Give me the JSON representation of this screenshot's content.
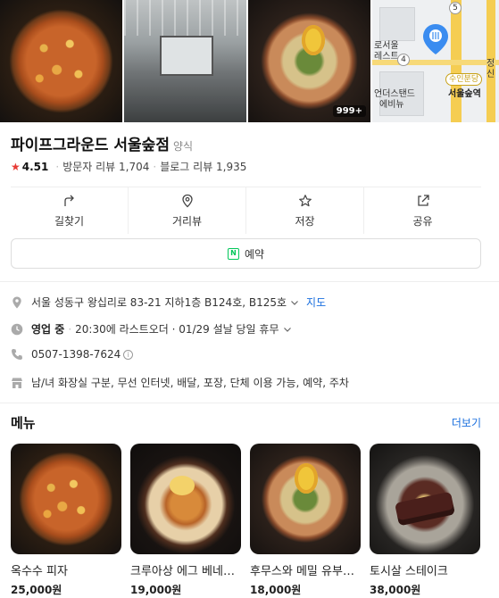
{
  "photos": {
    "count_badge": "999+"
  },
  "map": {
    "labels": [
      "로서울",
      "레스트",
      "언더스탠드",
      "에비뉴"
    ],
    "badges": [
      "5",
      "4"
    ],
    "station_tag": "수인분당",
    "station_name": "서울숲역",
    "side_label": "정신"
  },
  "place": {
    "name": "파이프그라운드 서울숲점",
    "category": "양식",
    "rating": "4.51",
    "visitor_reviews": "방문자 리뷰 1,704",
    "blog_reviews": "블로그 리뷰 1,935"
  },
  "actions": [
    {
      "label": "길찾기",
      "icon": "directions-icon"
    },
    {
      "label": "거리뷰",
      "icon": "streetview-pin-icon"
    },
    {
      "label": "저장",
      "icon": "star-outline-icon"
    },
    {
      "label": "공유",
      "icon": "share-icon"
    }
  ],
  "reserve_label": "예약",
  "info": {
    "address": "서울 성동구 왕십리로 83-21 지하1층 B124호, B125호",
    "address_link": "지도",
    "status": "영업 중",
    "hours": "20:30에 라스트오더 · 01/29 설날 당일 휴무",
    "phone": "0507-1398-7624",
    "facilities": "남/녀 화장실 구분, 무선 인터넷, 배달, 포장, 단체 이용 가능, 예약, 주차"
  },
  "menu": {
    "title": "메뉴",
    "more_label": "더보기",
    "items": [
      {
        "name": "옥수수 피자",
        "price": "25,000원"
      },
      {
        "name": "크루아상 에그 베네딕트",
        "price": "19,000원"
      },
      {
        "name": "후무스와 메밀 유부초밥",
        "price": "18,000원"
      },
      {
        "name": "토시살 스테이크",
        "price": "38,000원"
      }
    ]
  },
  "colors": {
    "accent": "#1a6fde",
    "star": "#e73b35",
    "naver_green": "#03c75a"
  }
}
